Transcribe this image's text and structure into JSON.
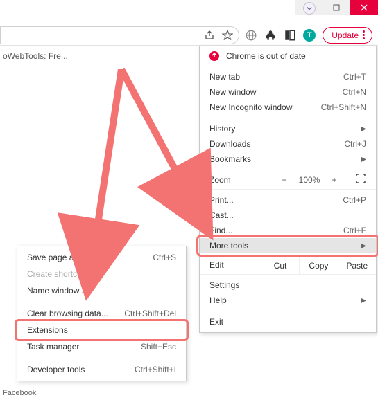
{
  "window": {
    "avatar_chevron": "▾"
  },
  "address": {
    "profile_letter": "T",
    "update_label": "Update"
  },
  "tab_remnant": "oWebTools: Fre...",
  "footer_text": "Facebook",
  "menu": {
    "warning": "Chrome is out of date",
    "sect1": [
      {
        "label": "New tab",
        "shortcut": "Ctrl+T"
      },
      {
        "label": "New window",
        "shortcut": "Ctrl+N"
      },
      {
        "label": "New Incognito window",
        "shortcut": "Ctrl+Shift+N"
      }
    ],
    "sect2": [
      {
        "label": "History",
        "shortcut": "",
        "arrow": true
      },
      {
        "label": "Downloads",
        "shortcut": "Ctrl+J"
      },
      {
        "label": "Bookmarks",
        "shortcut": "",
        "arrow": true
      }
    ],
    "zoom": {
      "label": "Zoom",
      "minus": "−",
      "pct": "100%",
      "plus": "+",
      "fs": "⛶"
    },
    "sect3": [
      {
        "label": "Print...",
        "shortcut": "Ctrl+P"
      },
      {
        "label": "Cast...",
        "shortcut": ""
      },
      {
        "label": "Find...",
        "shortcut": "Ctrl+F"
      },
      {
        "label": "More tools",
        "shortcut": "",
        "arrow": true,
        "hl": true
      }
    ],
    "edit": {
      "label": "Edit",
      "cut": "Cut",
      "copy": "Copy",
      "paste": "Paste"
    },
    "sect4": [
      {
        "label": "Settings",
        "shortcut": ""
      },
      {
        "label": "Help",
        "shortcut": "",
        "arrow": true
      }
    ],
    "sect5": [
      {
        "label": "Exit",
        "shortcut": ""
      }
    ]
  },
  "submenu": {
    "items": [
      {
        "label": "Save page as...",
        "shortcut": "Ctrl+S"
      },
      {
        "label": "Create shortcut...",
        "shortcut": "",
        "disabled": true
      },
      {
        "label": "Name window...",
        "shortcut": ""
      },
      {
        "sep": true
      },
      {
        "label": "Clear browsing data...",
        "shortcut": "Ctrl+Shift+Del"
      },
      {
        "label": "Extensions",
        "shortcut": "",
        "hl": true
      },
      {
        "label": "Task manager",
        "shortcut": "Shift+Esc"
      },
      {
        "sep": true
      },
      {
        "label": "Developer tools",
        "shortcut": "Ctrl+Shift+I"
      }
    ]
  }
}
